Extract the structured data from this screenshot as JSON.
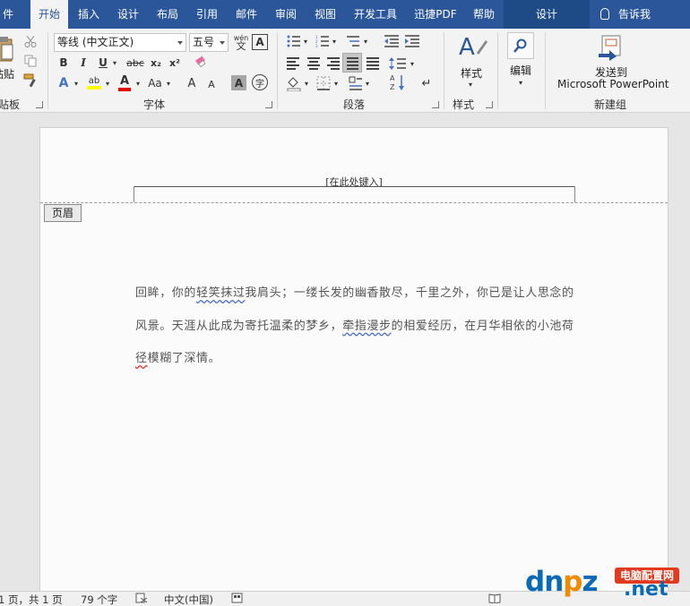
{
  "tabs": [
    "件",
    "开始",
    "插入",
    "设计",
    "布局",
    "引用",
    "邮件",
    "审阅",
    "视图",
    "开发工具",
    "迅捷PDF",
    "帮助",
    "设计"
  ],
  "tell_me": "告诉我",
  "clipboard": {
    "paste": "粘贴",
    "group": "贴板"
  },
  "font": {
    "name": "等线 (中文正文)",
    "size": "五号",
    "wen": "wén",
    "bold": "B",
    "italic": "I",
    "underline": "U",
    "strike": "abc",
    "subscript": "x₂",
    "superscript": "x²",
    "text_effect": "A",
    "highlight": "ab",
    "font_color": "A",
    "case": "Aa",
    "grow": "A",
    "shrink": "A",
    "shade": "A",
    "enclose": "字",
    "group": "字体"
  },
  "paragraph": {
    "group": "段落"
  },
  "styles": {
    "label": "样式",
    "group": "样式"
  },
  "editing": {
    "label": "编辑"
  },
  "newgroup": {
    "label1": "发送到",
    "label2": "Microsoft PowerPoint",
    "group": "新建组"
  },
  "document": {
    "header_placeholder": "[在此处键入]",
    "header_tag": "页眉",
    "text_1": "回眸，你的",
    "text_1_sq": "轻笑抹过",
    "text_2": "我肩头；一缕长发的幽香散尽，千里之外，你已是让人思念的风景。天涯从此成为寄托温柔的梦乡，",
    "text_2_sq": "牵指漫步",
    "text_3": "的相爱经历，在月华相依的小池荷",
    "text_3_sq": "径",
    "text_4": "模糊了深情。"
  },
  "status": {
    "page": "1 页，共 1 页",
    "words": "79 个字",
    "lang": "中文(中国)"
  },
  "watermark": {
    "main_1": "dn",
    "main_2": "p",
    "main_3": "z",
    "badge": "电脑配置网",
    "net": ".net"
  }
}
